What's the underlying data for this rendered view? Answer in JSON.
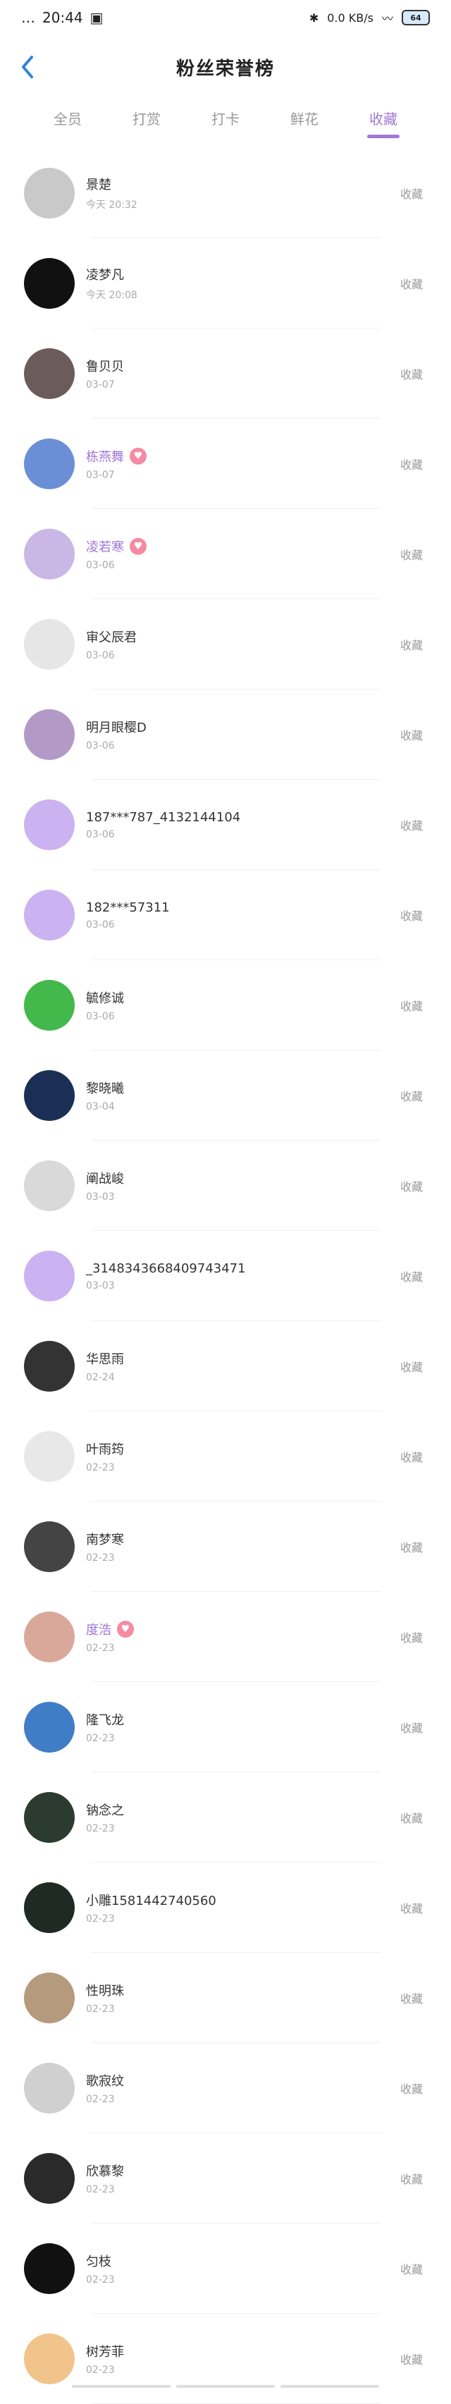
{
  "status": {
    "time": "20:44",
    "signal_text": "…",
    "battery": "64",
    "net": "0.0 KB/s"
  },
  "header": {
    "title": "粉丝荣誉榜"
  },
  "tabs": [
    {
      "label": "全员"
    },
    {
      "label": "打赏"
    },
    {
      "label": "打卡"
    },
    {
      "label": "鲜花"
    },
    {
      "label": "收藏"
    }
  ],
  "list": [
    {
      "name": "景楚",
      "date": "今天 20:32",
      "action": "收藏",
      "vip": false,
      "avatar_color": "#c9c9c9"
    },
    {
      "name": "凌梦凡",
      "date": "今天 20:08",
      "action": "收藏",
      "vip": false,
      "avatar_color": "#111111"
    },
    {
      "name": "鲁贝贝",
      "date": "03-07",
      "action": "收藏",
      "vip": false,
      "avatar_color": "#6b5b5b"
    },
    {
      "name": "栋燕舞",
      "date": "03-07",
      "action": "收藏",
      "vip": true,
      "avatar_color": "#6b8fd6"
    },
    {
      "name": "凌若寒",
      "date": "03-06",
      "action": "收藏",
      "vip": true,
      "avatar_color": "#c9b7e6"
    },
    {
      "name": "审父辰君",
      "date": "03-06",
      "action": "收藏",
      "vip": false,
      "avatar_color": "#e6e6e6"
    },
    {
      "name": "明月眼樱D",
      "date": "03-06",
      "action": "收藏",
      "vip": false,
      "avatar_color": "#b39ac6"
    },
    {
      "name": "187***787_4132144104",
      "date": "03-06",
      "action": "收藏",
      "vip": false,
      "avatar_color": "#cbb2f0"
    },
    {
      "name": "182***57311",
      "date": "03-06",
      "action": "收藏",
      "vip": false,
      "avatar_color": "#cbb2f0"
    },
    {
      "name": "毓修诚",
      "date": "03-06",
      "action": "收藏",
      "vip": false,
      "avatar_color": "#43b84b"
    },
    {
      "name": "黎晓曦",
      "date": "03-04",
      "action": "收藏",
      "vip": false,
      "avatar_color": "#1b2f55"
    },
    {
      "name": "阐战峻",
      "date": "03-03",
      "action": "收藏",
      "vip": false,
      "avatar_color": "#d9d9d9"
    },
    {
      "name": "_3148343668409743471",
      "date": "03-03",
      "action": "收藏",
      "vip": false,
      "avatar_color": "#cbb2f0"
    },
    {
      "name": "华思雨",
      "date": "02-24",
      "action": "收藏",
      "vip": false,
      "avatar_color": "#333333"
    },
    {
      "name": "叶雨筠",
      "date": "02-23",
      "action": "收藏",
      "vip": false,
      "avatar_color": "#e8e8e8"
    },
    {
      "name": "南梦寒",
      "date": "02-23",
      "action": "收藏",
      "vip": false,
      "avatar_color": "#444444"
    },
    {
      "name": "度浩",
      "date": "02-23",
      "action": "收藏",
      "vip": true,
      "avatar_color": "#d9a89a"
    },
    {
      "name": "隆飞龙",
      "date": "02-23",
      "action": "收藏",
      "vip": false,
      "avatar_color": "#3f7ec7"
    },
    {
      "name": "钠念之",
      "date": "02-23",
      "action": "收藏",
      "vip": false,
      "avatar_color": "#2c3b2f"
    },
    {
      "name": "小雕1581442740560",
      "date": "02-23",
      "action": "收藏",
      "vip": false,
      "avatar_color": "#1e2a22"
    },
    {
      "name": "性明珠",
      "date": "02-23",
      "action": "收藏",
      "vip": false,
      "avatar_color": "#b59a7c"
    },
    {
      "name": "歌寂纹",
      "date": "02-23",
      "action": "收藏",
      "vip": false,
      "avatar_color": "#d0d0d0"
    },
    {
      "name": "欣慕黎",
      "date": "02-23",
      "action": "收藏",
      "vip": false,
      "avatar_color": "#2a2a2a"
    },
    {
      "name": "匀枝",
      "date": "02-23",
      "action": "收藏",
      "vip": false,
      "avatar_color": "#111111"
    },
    {
      "name": "树芳菲",
      "date": "02-23",
      "action": "收藏",
      "vip": false,
      "avatar_color": "#f0c48a"
    }
  ]
}
